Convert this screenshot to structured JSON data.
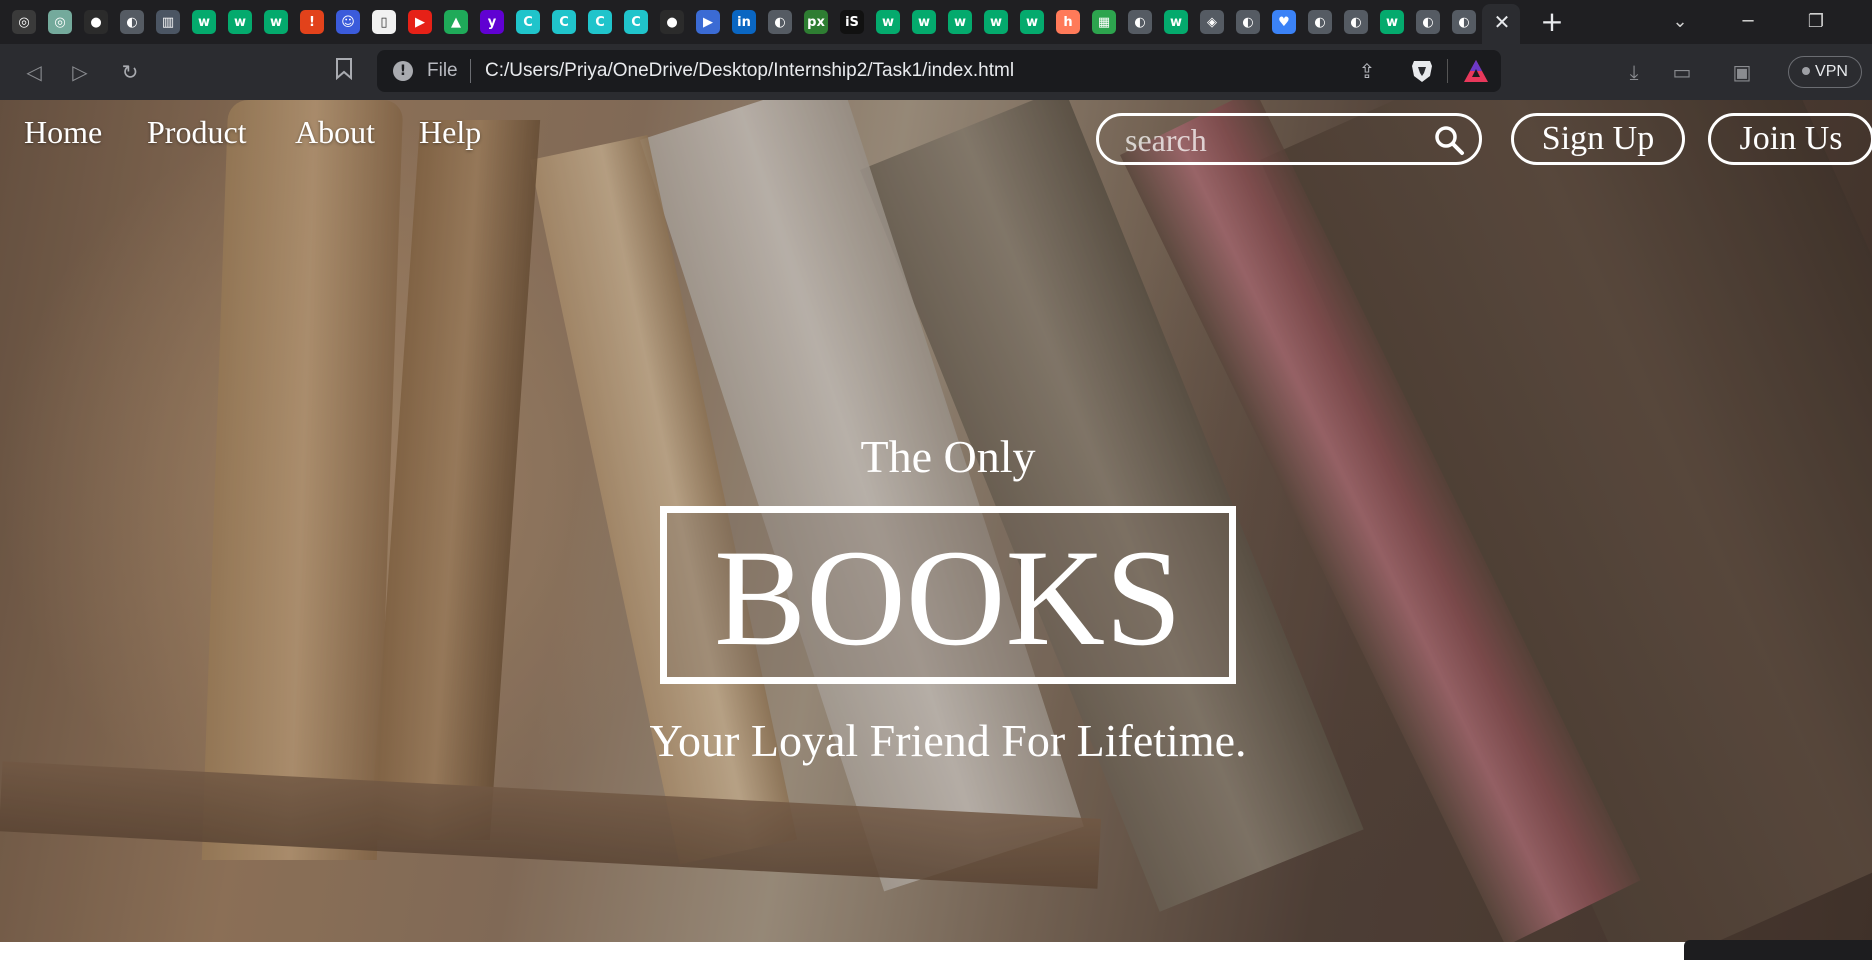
{
  "browser": {
    "tabs": [
      {
        "icon": "openai-icon",
        "color": "#3a3a3a",
        "glyph": "◎"
      },
      {
        "icon": "chatgpt-icon",
        "color": "#74aa9c",
        "glyph": "◎"
      },
      {
        "icon": "github-icon",
        "color": "#2b2b2b",
        "glyph": "●"
      },
      {
        "icon": "globe-icon",
        "color": "#555b63",
        "glyph": "◐"
      },
      {
        "icon": "book-icon",
        "color": "#4b5563",
        "glyph": "▥"
      },
      {
        "icon": "w3schools-icon",
        "color": "#04aa6d",
        "glyph": "w"
      },
      {
        "icon": "w3schools-icon",
        "color": "#04aa6d",
        "glyph": "w"
      },
      {
        "icon": "w3schools-icon",
        "color": "#04aa6d",
        "glyph": "w"
      },
      {
        "icon": "alert-icon",
        "color": "#e2421b",
        "glyph": "!"
      },
      {
        "icon": "smiley-icon",
        "color": "#3b5bdb",
        "glyph": "☺"
      },
      {
        "icon": "document-icon",
        "color": "#f1f1f1",
        "glyph": "▯"
      },
      {
        "icon": "youtube-icon",
        "color": "#e62117",
        "glyph": "▶"
      },
      {
        "icon": "drive-icon",
        "color": "#1faa59",
        "glyph": "▲"
      },
      {
        "icon": "yahoo-icon",
        "color": "#6001d2",
        "glyph": "y"
      },
      {
        "icon": "canva-icon",
        "color": "#20c4cb",
        "glyph": "C"
      },
      {
        "icon": "canva-icon",
        "color": "#20c4cb",
        "glyph": "C"
      },
      {
        "icon": "canva-icon",
        "color": "#20c4cb",
        "glyph": "C"
      },
      {
        "icon": "canva-icon",
        "color": "#20c4cb",
        "glyph": "C"
      },
      {
        "icon": "github-icon",
        "color": "#2b2b2b",
        "glyph": "●"
      },
      {
        "icon": "video-icon",
        "color": "#3b6bd4",
        "glyph": "▶"
      },
      {
        "icon": "linkedin-icon",
        "color": "#0a66c2",
        "glyph": "in"
      },
      {
        "icon": "globe-icon",
        "color": "#555b63",
        "glyph": "◐"
      },
      {
        "icon": "pixel-icon",
        "color": "#2e7d32",
        "glyph": "px"
      },
      {
        "icon": "is-icon",
        "color": "#111111",
        "glyph": "iS"
      },
      {
        "icon": "w3schools-icon",
        "color": "#04aa6d",
        "glyph": "w"
      },
      {
        "icon": "w3schools-icon",
        "color": "#04aa6d",
        "glyph": "w"
      },
      {
        "icon": "w3schools-icon",
        "color": "#04aa6d",
        "glyph": "w"
      },
      {
        "icon": "w3schools-icon",
        "color": "#04aa6d",
        "glyph": "w"
      },
      {
        "icon": "w3schools-icon",
        "color": "#04aa6d",
        "glyph": "w"
      },
      {
        "icon": "hubspot-icon",
        "color": "#ff7a59",
        "glyph": "h"
      },
      {
        "icon": "grid-icon",
        "color": "#2da44e",
        "glyph": "▦"
      },
      {
        "icon": "globe-icon",
        "color": "#555b63",
        "glyph": "◐"
      },
      {
        "icon": "w3schools-icon",
        "color": "#04aa6d",
        "glyph": "w"
      },
      {
        "icon": "layers-icon",
        "color": "#555b63",
        "glyph": "◈"
      },
      {
        "icon": "globe-icon",
        "color": "#555b63",
        "glyph": "◐"
      },
      {
        "icon": "heart-icon",
        "color": "#3b82f6",
        "glyph": "♥"
      },
      {
        "icon": "globe-icon",
        "color": "#555b63",
        "glyph": "◐"
      },
      {
        "icon": "globe-icon",
        "color": "#555b63",
        "glyph": "◐"
      },
      {
        "icon": "w3schools-icon",
        "color": "#04aa6d",
        "glyph": "w"
      },
      {
        "icon": "globe-icon",
        "color": "#555b63",
        "glyph": "◐"
      },
      {
        "icon": "globe-icon",
        "color": "#555b63",
        "glyph": "◐"
      }
    ],
    "address": {
      "scheme_label": "File",
      "url": "C:/Users/Priya/OneDrive/Desktop/Internship2/Task1/index.html"
    },
    "vpn_label": "VPN"
  },
  "site": {
    "nav": [
      {
        "label": "Home"
      },
      {
        "label": "Product"
      },
      {
        "label": "About"
      },
      {
        "label": "Help"
      }
    ],
    "search": {
      "placeholder": "search"
    },
    "signup_label": "Sign Up",
    "join_label": "Join Us",
    "hero": {
      "subtitle": "The Only",
      "title": "BOOKS",
      "tagline": "Your Loyal Friend For Lifetime."
    }
  },
  "colors": {
    "accent": "#ffffff",
    "browser_bg": "#1f1f22",
    "toolbar_bg": "#2b2c30"
  }
}
